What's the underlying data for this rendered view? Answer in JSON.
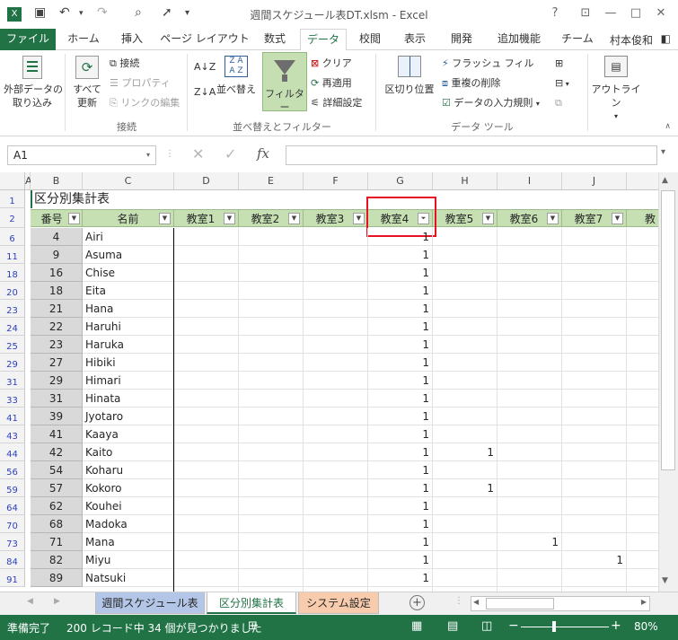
{
  "window": {
    "title": "週間スケジュール表DT.xlsm - Excel",
    "help": "?",
    "minimize": "—",
    "restore": "□",
    "close": "✕"
  },
  "ribbon_tabs": [
    "ファイル",
    "ホーム",
    "挿入",
    "ページ レイアウト",
    "数式",
    "データ",
    "校閲",
    "表示",
    "開発",
    "追加機能",
    "チーム"
  ],
  "active_tab": "データ",
  "user_name": "村本俊和",
  "ribbon": {
    "get_external": "外部データの\n取り込み",
    "refresh_all": "すべて\n更新",
    "connections": "接続",
    "properties": "プロパティ",
    "edit_links": "リンクの編集",
    "group_connections": "接続",
    "sort_asc": "A↓Z",
    "sort_desc": "Z↓A",
    "sort": "並べ替え",
    "filter": "フィルター",
    "clear": "クリア",
    "reapply": "再適用",
    "advanced": "詳細設定",
    "group_sort_filter": "並べ替えとフィルター",
    "text_to_columns": "区切り位置",
    "flash_fill": "フラッシュ フィル",
    "remove_duplicates": "重複の削除",
    "data_validation": "データの入力規則",
    "group_data_tools": "データ ツール",
    "outline": "アウトライン"
  },
  "formula_bar": {
    "name_box": "A1",
    "fx": "fx",
    "formula": ""
  },
  "columns": [
    "A",
    "B",
    "C",
    "D",
    "E",
    "F",
    "G",
    "H",
    "I",
    "J"
  ],
  "sheet": {
    "title": "区分別集計表",
    "headers": [
      "番号",
      "名前",
      "教室1",
      "教室2",
      "教室3",
      "教室4",
      "教室5",
      "教室6",
      "教室7",
      "教"
    ],
    "rows": [
      {
        "row": "6",
        "num": "4",
        "name": "Airi",
        "g": "1",
        "h": "",
        "i": "",
        "j": ""
      },
      {
        "row": "11",
        "num": "9",
        "name": "Asuma",
        "g": "1",
        "h": "",
        "i": "",
        "j": ""
      },
      {
        "row": "18",
        "num": "16",
        "name": "Chise",
        "g": "1",
        "h": "",
        "i": "",
        "j": ""
      },
      {
        "row": "20",
        "num": "18",
        "name": "Eita",
        "g": "1",
        "h": "",
        "i": "",
        "j": ""
      },
      {
        "row": "23",
        "num": "21",
        "name": "Hana",
        "g": "1",
        "h": "",
        "i": "",
        "j": ""
      },
      {
        "row": "24",
        "num": "22",
        "name": "Haruhi",
        "g": "1",
        "h": "",
        "i": "",
        "j": ""
      },
      {
        "row": "25",
        "num": "23",
        "name": "Haruka",
        "g": "1",
        "h": "",
        "i": "",
        "j": ""
      },
      {
        "row": "29",
        "num": "27",
        "name": "Hibiki",
        "g": "1",
        "h": "",
        "i": "",
        "j": ""
      },
      {
        "row": "31",
        "num": "29",
        "name": "Himari",
        "g": "1",
        "h": "",
        "i": "",
        "j": ""
      },
      {
        "row": "33",
        "num": "31",
        "name": "Hinata",
        "g": "1",
        "h": "",
        "i": "",
        "j": ""
      },
      {
        "row": "41",
        "num": "39",
        "name": "Jyotaro",
        "g": "1",
        "h": "",
        "i": "",
        "j": ""
      },
      {
        "row": "43",
        "num": "41",
        "name": "Kaaya",
        "g": "1",
        "h": "",
        "i": "",
        "j": ""
      },
      {
        "row": "44",
        "num": "42",
        "name": "Kaito",
        "g": "1",
        "h": "1",
        "i": "",
        "j": ""
      },
      {
        "row": "56",
        "num": "54",
        "name": "Koharu",
        "g": "1",
        "h": "",
        "i": "",
        "j": ""
      },
      {
        "row": "59",
        "num": "57",
        "name": "Kokoro",
        "g": "1",
        "h": "1",
        "i": "",
        "j": ""
      },
      {
        "row": "64",
        "num": "62",
        "name": "Kouhei",
        "g": "1",
        "h": "",
        "i": "",
        "j": ""
      },
      {
        "row": "70",
        "num": "68",
        "name": "Madoka",
        "g": "1",
        "h": "",
        "i": "",
        "j": ""
      },
      {
        "row": "73",
        "num": "71",
        "name": "Mana",
        "g": "1",
        "h": "",
        "i": "1",
        "j": ""
      },
      {
        "row": "84",
        "num": "82",
        "name": "Miyu",
        "g": "1",
        "h": "",
        "i": "",
        "j": "1"
      },
      {
        "row": "91",
        "num": "89",
        "name": "Natsuki",
        "g": "1",
        "h": "",
        "i": "",
        "j": ""
      }
    ]
  },
  "sheet_tabs": [
    {
      "label": "週間スケジュール表",
      "color": "#b4c6e7"
    },
    {
      "label": "区分別集計表",
      "color": "#ffffff"
    },
    {
      "label": "システム設定",
      "color": "#f8cbad"
    }
  ],
  "active_sheet": "区分別集計表",
  "status": {
    "ready": "準備完了",
    "filter_info": "200 レコード中 34 個が見つかりました",
    "zoom": "80%"
  },
  "colors": {
    "excel_green": "#217346",
    "header_green": "#c6e0b4",
    "highlight_red": "#e81123"
  }
}
